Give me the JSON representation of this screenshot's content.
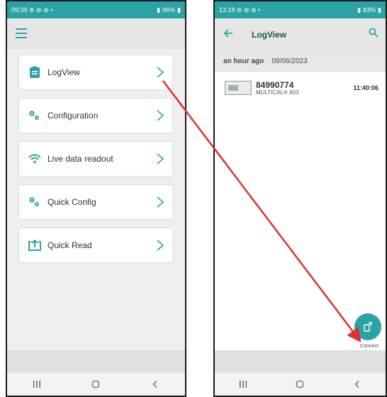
{
  "left_phone": {
    "status_time": "09:39",
    "status_icons": "⊛ ⊛ ⊛ •",
    "status_battery": "96%",
    "menu": [
      {
        "label": "LogView",
        "icon": "clipboard-icon"
      },
      {
        "label": "Configuration",
        "icon": "gears-icon"
      },
      {
        "label": "Live data readout",
        "icon": "wifi-icon"
      },
      {
        "label": "Quick Config",
        "icon": "gears-icon"
      },
      {
        "label": "Quick Read",
        "icon": "upload-icon"
      }
    ]
  },
  "right_phone": {
    "status_time": "13:19",
    "status_icons": "⊛ ⊛ ⊛ •",
    "status_battery": "83%",
    "title": "LogView",
    "group_time": "an hour ago",
    "group_sep": "·",
    "group_date": "09/06/2023",
    "meter_id": "84990774",
    "meter_model": "MULTICAL® 603",
    "meter_time": "11:40:06",
    "fab_label": "Connect"
  },
  "colors": {
    "accent": "#2aa2a6",
    "arrow": "#e03030"
  }
}
